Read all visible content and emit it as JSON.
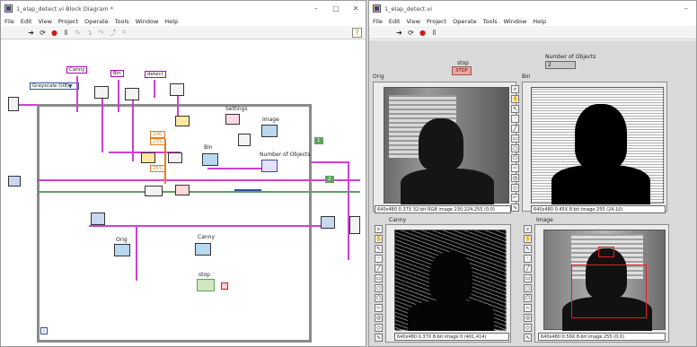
{
  "block_diagram": {
    "title": "1_elap_detect.vi Block Diagram *",
    "menu": [
      "File",
      "Edit",
      "View",
      "Project",
      "Operate",
      "Tools",
      "Window",
      "Help"
    ],
    "window_controls": [
      "–",
      "▢",
      "✕"
    ],
    "constants": {
      "canny": "Canny",
      "bin": "Bin",
      "detect": "detect",
      "grayscale": "Grayscale (U8)",
      "settings": "Settings",
      "image": "Image",
      "bin_label": "Bin",
      "number_of_objects": "Number of Objects",
      "orig": "Orig",
      "canny2": "Canny",
      "stop": "stop",
      "loop_index": "i",
      "num_a": "100",
      "num_b": "255",
      "num_c": "255",
      "num_d": "1",
      "num_e": "2"
    }
  },
  "front_panel": {
    "title": "1_elap_detect.vi",
    "menu": [
      "File",
      "Edit",
      "View",
      "Project",
      "Operate",
      "Tools",
      "Window",
      "Help"
    ],
    "window_controls": [
      "–"
    ],
    "stop_label": "stop",
    "stop_button": "STOP",
    "num_objects_label": "Number of Objects",
    "num_objects_value": "2",
    "displays": [
      {
        "label": "Orig",
        "status": "640x480 0.37X 32-bit RGB image 230,224,255   (0,0)"
      },
      {
        "label": "Bin",
        "status": "640x480 0.45X 8-bit image 255   (24,10)"
      },
      {
        "label": "Canny",
        "status": "640x480 0.37X 8-bit image 0   (401,414)"
      },
      {
        "label": "Image",
        "status": "640x480 0.59X 8-bit image 255   (0,0)"
      }
    ]
  },
  "colors": {
    "wire_pink": "#d040d0",
    "wire_green": "#60a060",
    "wire_orange": "#e08020",
    "wire_blue": "#3050a0",
    "stop_red": "#d01818"
  },
  "icons": [
    "run-arrow-icon",
    "run-continuous-icon",
    "abort-icon",
    "pause-icon",
    "zoom-icon",
    "hand-icon",
    "roi-icon",
    "vi-icon"
  ]
}
